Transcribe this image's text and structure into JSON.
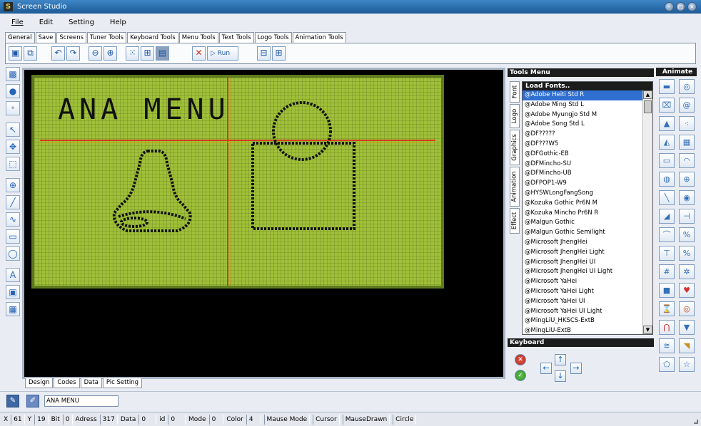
{
  "window": {
    "title": "Screen Studio"
  },
  "menu": [
    "File",
    "Edit",
    "Setting",
    "Help"
  ],
  "tabs": [
    "General",
    "Save",
    "Screens",
    "Tuner Tools",
    "Keyboard Tools",
    "Menu Tools",
    "Text Tools",
    "Logo Tools",
    "Animation Tools"
  ],
  "toolbar": {
    "run_label": "Run"
  },
  "lcd": {
    "text": "ANA MENU"
  },
  "bottom_tabs": [
    "Design",
    "Codes",
    "Data",
    "Pic Setting"
  ],
  "tools_menu": {
    "title": "Tools Menu",
    "side_tabs": [
      "Font",
      "Logo",
      "Graphics",
      "Animation",
      "Effect"
    ],
    "list_header": "Load Fonts..",
    "fonts": [
      "@Adobe Heiti Std R",
      "@Adobe Ming Std L",
      "@Adobe Myungjo Std M",
      "@Adobe Song Std L",
      "@DF?????",
      "@DF???W5",
      "@DFGothic-EB",
      "@DFMincho-SU",
      "@DFMincho-UB",
      "@DFPOP1-W9",
      "@HYSWLongFangSong",
      "@Kozuka Gothic Pr6N M",
      "@Kozuka Mincho Pr6N R",
      "@Malgun Gothic",
      "@Malgun Gothic Semilight",
      "@Microsoft JhengHei",
      "@Microsoft JhengHei Light",
      "@Microsoft JhengHei UI",
      "@Microsoft JhengHei UI Light",
      "@Microsoft YaHei",
      "@Microsoft YaHei Light",
      "@Microsoft YaHei UI",
      "@Microsoft YaHei UI Light",
      "@MingLiU_HKSCS-ExtB",
      "@MingLiU-ExtB"
    ],
    "selected_index": 0
  },
  "keyboard": {
    "title": "Keyboard"
  },
  "animate": {
    "title": "Animate"
  },
  "cursor_name": "ANA MENU",
  "status": {
    "x_label": "X",
    "x": "61",
    "y_label": "Y",
    "y": "19",
    "bit_label": "Bit",
    "bit": "0",
    "adress_label": "Adress",
    "adress": "317",
    "data_label": "Data",
    "data": "0",
    "id_label": "id",
    "id": "0",
    "mode_label": "Mode",
    "mode": "0",
    "color_label": "Color",
    "color": "4",
    "mouse_mode": "Mause Mode",
    "cursor": "Cursor",
    "mouse_drawn": "MauseDrawn",
    "shape": "Circle"
  },
  "colors": {
    "lcd_bg": "#9fc038",
    "guide_line": "#d23c1c",
    "accent": "#1c5a96"
  }
}
